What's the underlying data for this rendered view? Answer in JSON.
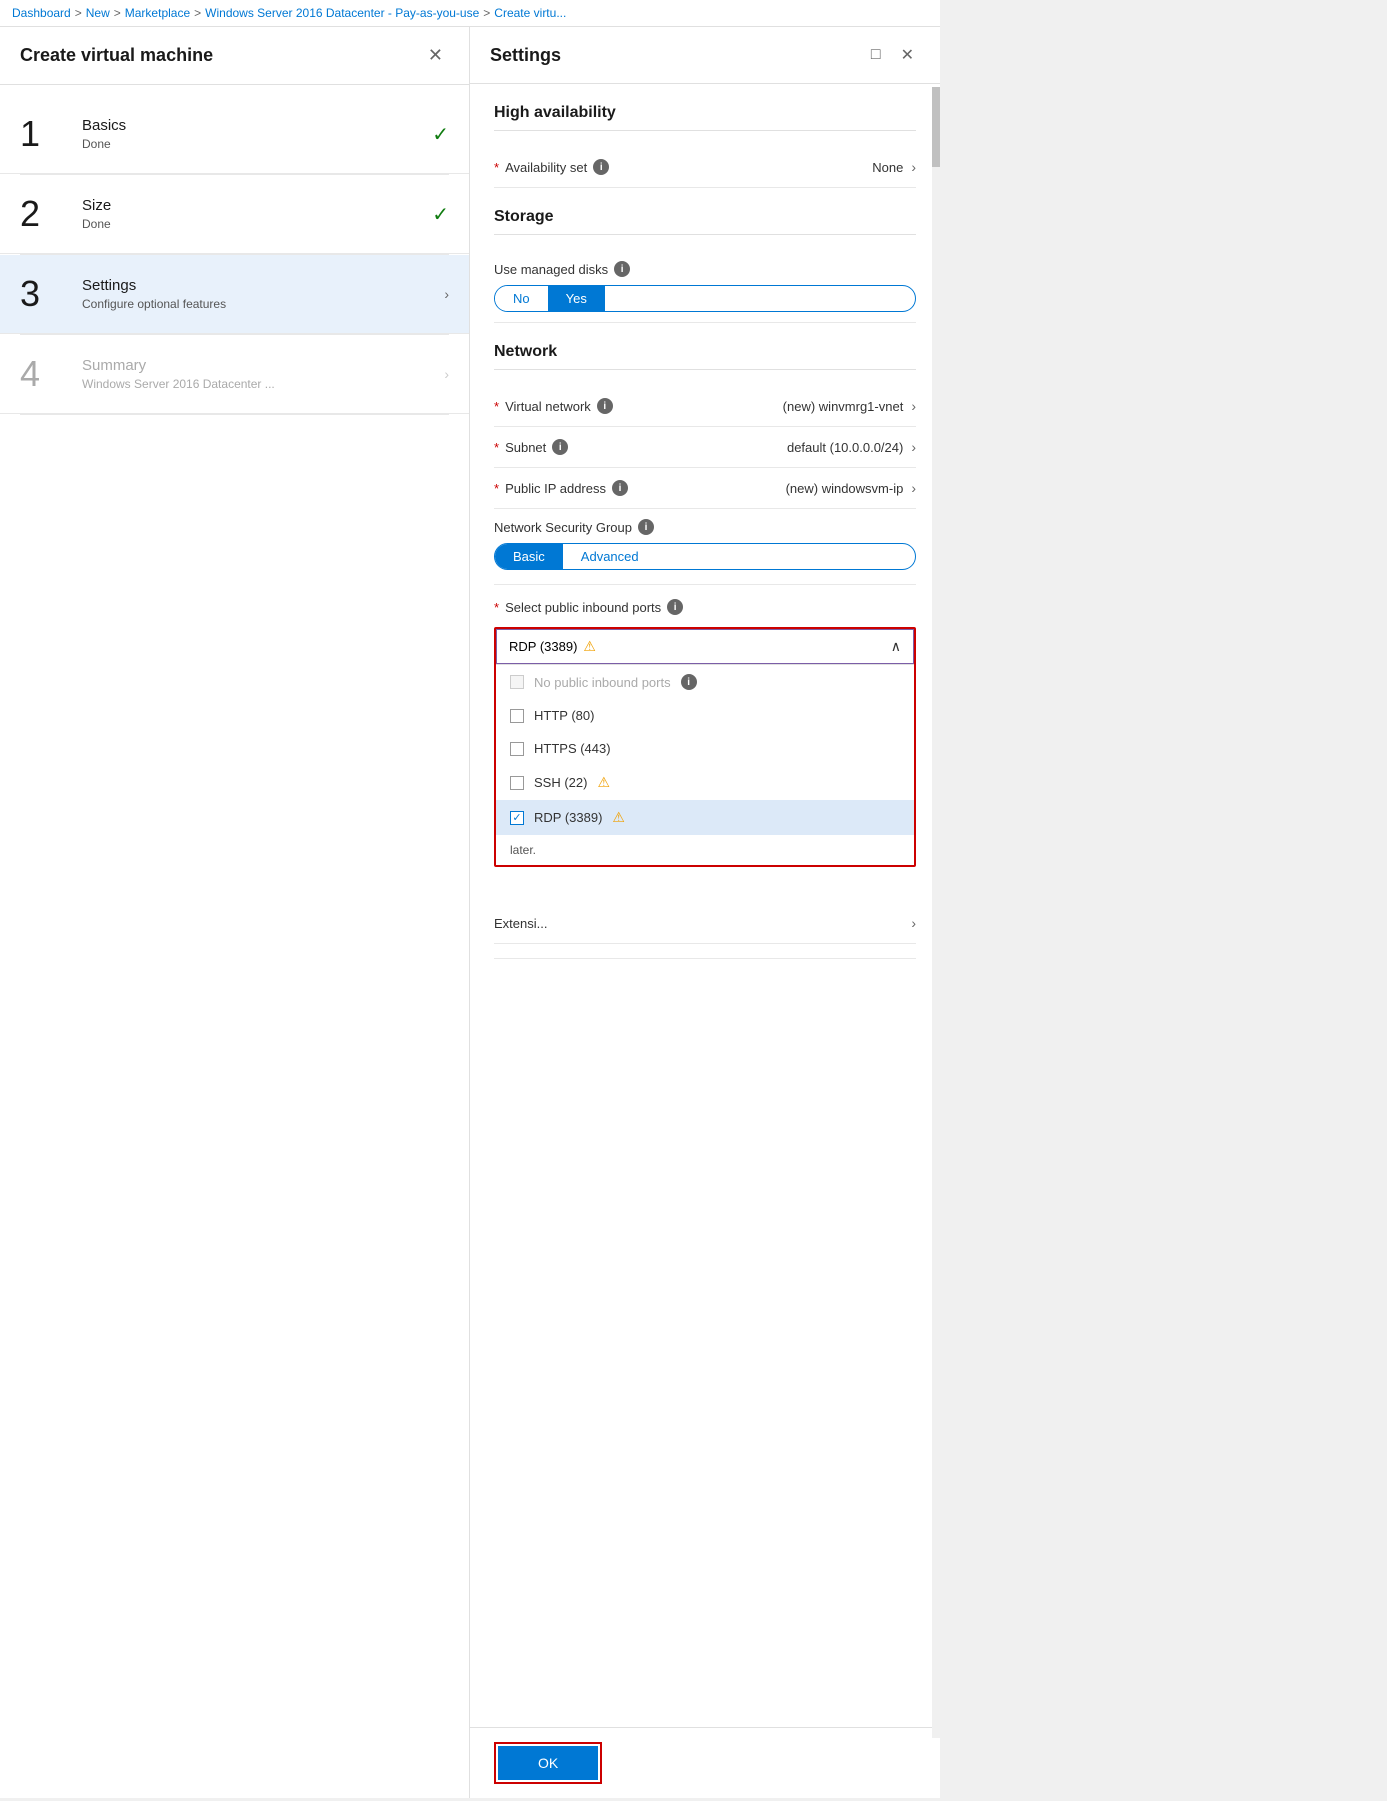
{
  "breadcrumb": {
    "items": [
      "Dashboard",
      "New",
      "Marketplace",
      "Windows Server 2016 Datacenter - Pay-as-you-use",
      "Create virtu..."
    ],
    "separators": [
      ">",
      ">",
      ">",
      ">"
    ]
  },
  "left_panel": {
    "title": "Create virtual machine",
    "close_label": "✕",
    "steps": [
      {
        "number": "1",
        "title": "Basics",
        "subtitle": "Done",
        "status": "done",
        "active": false
      },
      {
        "number": "2",
        "title": "Size",
        "subtitle": "Done",
        "status": "done",
        "active": false
      },
      {
        "number": "3",
        "title": "Settings",
        "subtitle": "Configure optional features",
        "status": "active",
        "active": true
      },
      {
        "number": "4",
        "title": "Summary",
        "subtitle": "Windows Server 2016 Datacenter ...",
        "status": "pending",
        "active": false
      }
    ]
  },
  "right_panel": {
    "title": "Settings",
    "sections": {
      "high_availability": {
        "title": "High availability",
        "availability_set": {
          "label": "Availability set",
          "required": true,
          "has_info": true,
          "value": "None"
        }
      },
      "storage": {
        "title": "Storage",
        "managed_disks": {
          "label": "Use managed disks",
          "has_info": true,
          "options": [
            "No",
            "Yes"
          ],
          "selected": "Yes"
        }
      },
      "network": {
        "title": "Network",
        "virtual_network": {
          "label": "Virtual network",
          "required": true,
          "has_info": true,
          "value": "(new) winvmrg1-vnet"
        },
        "subnet": {
          "label": "Subnet",
          "required": true,
          "has_info": true,
          "value": "default (10.0.0.0/24)"
        },
        "public_ip": {
          "label": "Public IP address",
          "required": true,
          "has_info": true,
          "value": "(new) windowsvm-ip"
        },
        "nsg": {
          "label": "Network Security Group",
          "has_info": true,
          "options": [
            "Basic",
            "Advanced"
          ],
          "selected": "Basic"
        },
        "inbound_ports": {
          "label": "Select public inbound ports",
          "required": true,
          "has_info": true,
          "dropdown_value": "RDP (3389)",
          "has_warning": true,
          "items": [
            {
              "label": "No public inbound ports",
              "checked": false,
              "disabled": true,
              "has_info": true
            },
            {
              "label": "HTTP (80)",
              "checked": false,
              "disabled": false
            },
            {
              "label": "HTTPS (443)",
              "checked": false,
              "disabled": false
            },
            {
              "label": "SSH (22)",
              "checked": false,
              "disabled": false,
              "has_warning": true
            },
            {
              "label": "RDP (3389)",
              "checked": true,
              "disabled": false,
              "has_warning": true,
              "selected": true
            }
          ],
          "note": "later."
        }
      },
      "extensions": {
        "label": "Extensi..."
      }
    },
    "ok_button": "OK"
  },
  "icons": {
    "check": "✓",
    "chevron_right": "›",
    "chevron_up": "∧",
    "info": "i",
    "warning": "⚠",
    "close": "✕",
    "maximize": "□",
    "checkmark": "✓"
  }
}
